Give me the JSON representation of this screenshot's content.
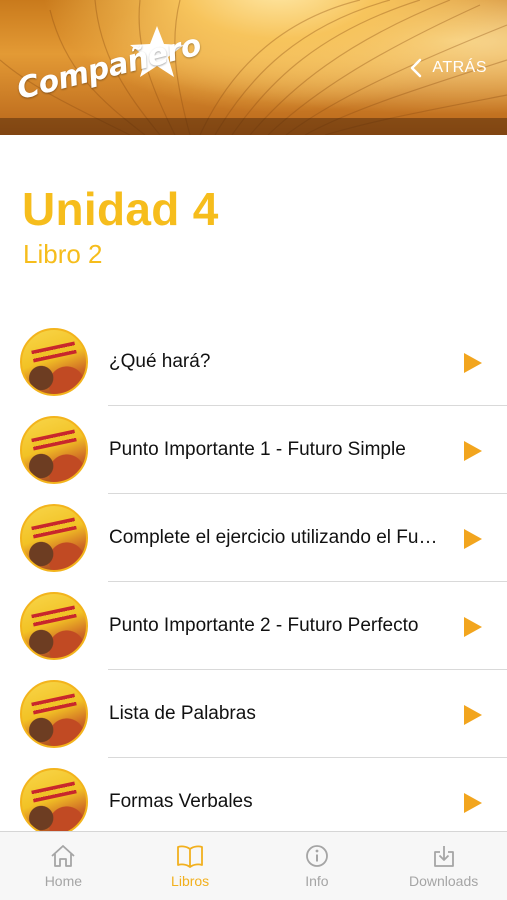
{
  "header": {
    "logo_text": "Compañero",
    "back_label": "ATRÁS"
  },
  "page": {
    "title": "Unidad 4",
    "subtitle": "Libro 2"
  },
  "list": {
    "items": [
      {
        "label": "¿Qué hará?"
      },
      {
        "label": "Punto Importante 1 - Futuro Simple"
      },
      {
        "label": "Complete el ejercicio utilizando el Futuro Simple"
      },
      {
        "label": "Punto Importante 2 - Futuro Perfecto"
      },
      {
        "label": "Lista de Palabras"
      },
      {
        "label": "Formas Verbales"
      }
    ]
  },
  "tabbar": {
    "tabs": [
      {
        "label": "Home",
        "icon": "home-icon",
        "active": false
      },
      {
        "label": "Libros",
        "icon": "book-icon",
        "active": true
      },
      {
        "label": "Info",
        "icon": "info-icon",
        "active": false
      },
      {
        "label": "Downloads",
        "icon": "download-icon",
        "active": false
      }
    ]
  },
  "colors": {
    "accent": "#f6bd1c",
    "play": "#f2a51e",
    "tab_inactive": "#a5a5a5",
    "text": "#111111"
  }
}
